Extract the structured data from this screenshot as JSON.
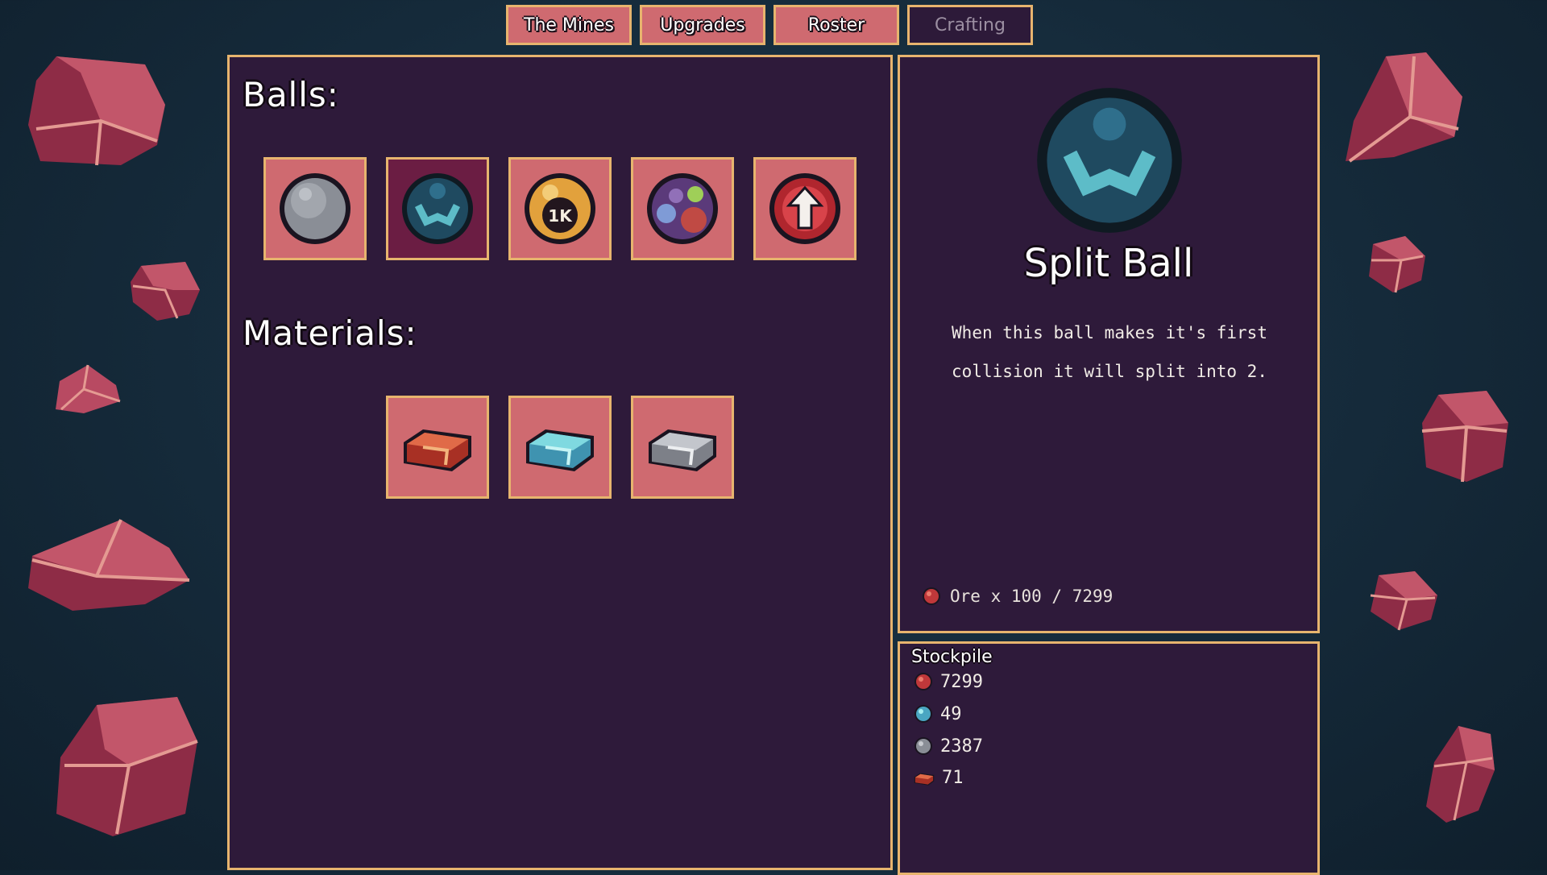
{
  "tabs": [
    {
      "label": "The Mines",
      "active": false
    },
    {
      "label": "Upgrades",
      "active": false
    },
    {
      "label": "Roster",
      "active": false
    },
    {
      "label": "Crafting",
      "active": true
    }
  ],
  "crafting": {
    "balls_title": "Balls:",
    "materials_title": "Materials:",
    "balls": [
      {
        "name": "stone-ball",
        "icon": "gray-ball-icon"
      },
      {
        "name": "split-ball",
        "icon": "split-ball-icon",
        "selected": true
      },
      {
        "name": "1k-ball",
        "icon": "1k-ball-icon",
        "badge": "1K"
      },
      {
        "name": "multicolor-ball",
        "icon": "rainbow-ball-icon"
      },
      {
        "name": "arrow-ball",
        "icon": "arrow-up-ball-icon"
      }
    ],
    "materials": [
      {
        "name": "red-ingot",
        "icon": "red-ingot-icon"
      },
      {
        "name": "cyan-ingot",
        "icon": "cyan-ingot-icon"
      },
      {
        "name": "silver-ingot",
        "icon": "silver-ingot-icon"
      }
    ]
  },
  "detail": {
    "name": "Split Ball",
    "description": "When this ball makes it's first collision it will split into 2.",
    "cost_text": "Ore x 100 / 7299",
    "cost_icon": "red-ore-icon"
  },
  "stockpile": {
    "title": "Stockpile",
    "items": [
      {
        "icon": "red-ore-icon",
        "value": "7299"
      },
      {
        "icon": "cyan-ore-icon",
        "value": "49"
      },
      {
        "icon": "gray-ore-icon",
        "value": "2387"
      },
      {
        "icon": "red-ingot-icon",
        "value": "71"
      }
    ]
  },
  "colors": {
    "background": "#152a3a",
    "panel": "#2e1a3a",
    "panel_border": "#e7b46e",
    "slot": "#cf6a70",
    "slot_selected": "#6b1d43",
    "rock": "#a8374f"
  }
}
